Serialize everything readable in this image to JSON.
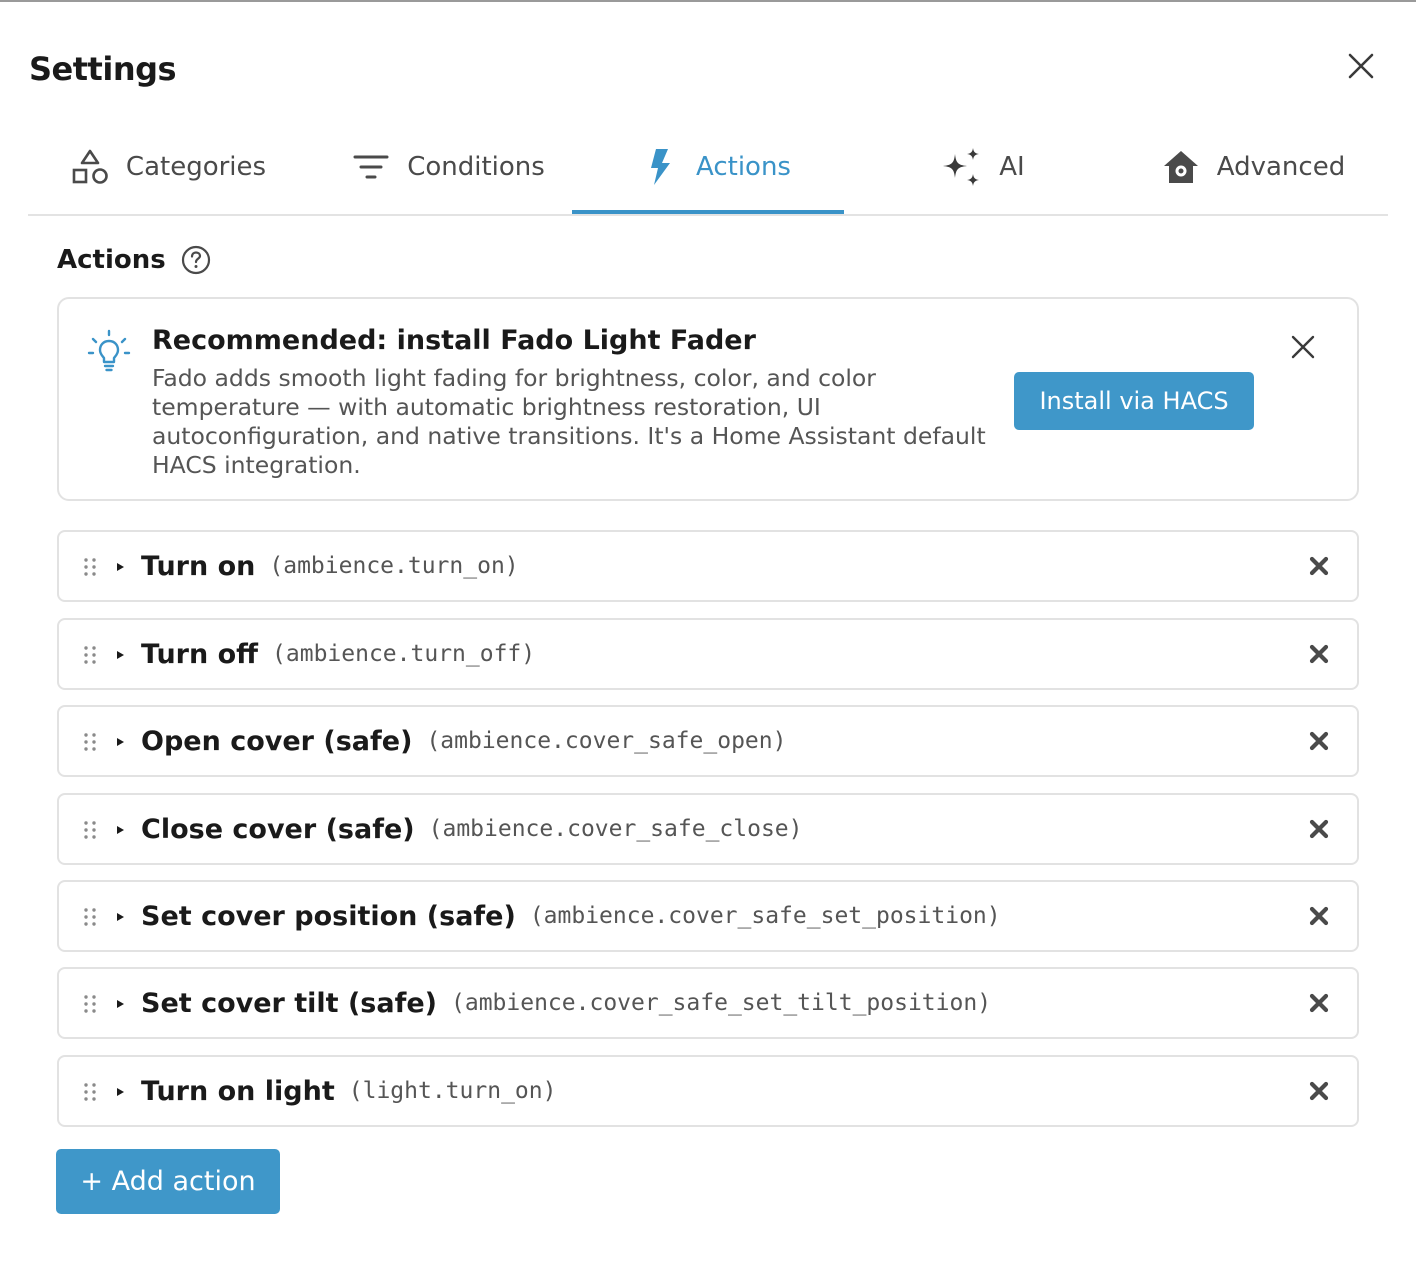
{
  "dialog": {
    "title": "Settings"
  },
  "tabs": [
    {
      "label": "Categories",
      "icon": "shapes-icon"
    },
    {
      "label": "Conditions",
      "icon": "filter-icon"
    },
    {
      "label": "Actions",
      "icon": "lightning-icon",
      "active": true
    },
    {
      "label": "AI",
      "icon": "sparkles-icon"
    },
    {
      "label": "Advanced",
      "icon": "home-gear-icon"
    }
  ],
  "section": {
    "title": "Actions",
    "help_icon": "help-circle-icon"
  },
  "recommendation": {
    "icon": "lightbulb-icon",
    "title": "Recommended: install Fado Light Fader",
    "body": "Fado adds smooth light fading for brightness, color, and color temperature — with automatic brightness restoration, UI autoconfiguration, and native transitions. It's a Home Assistant default HACS integration.",
    "button": "Install via HACS"
  },
  "actions": [
    {
      "name": "Turn on",
      "service": "(ambience.turn_on)"
    },
    {
      "name": "Turn off",
      "service": "(ambience.turn_off)"
    },
    {
      "name": "Open cover (safe)",
      "service": "(ambience.cover_safe_open)"
    },
    {
      "name": "Close cover (safe)",
      "service": "(ambience.cover_safe_close)"
    },
    {
      "name": "Set cover position (safe)",
      "service": "(ambience.cover_safe_set_position)"
    },
    {
      "name": "Set cover tilt (safe)",
      "service": "(ambience.cover_safe_set_tilt_position)"
    },
    {
      "name": "Turn on light",
      "service": "(light.turn_on)"
    }
  ],
  "add_button": "+ Add action",
  "colors": {
    "accent": "#3f97c9",
    "active_tab": "#3a93c8",
    "border": "#e2e2e2"
  }
}
